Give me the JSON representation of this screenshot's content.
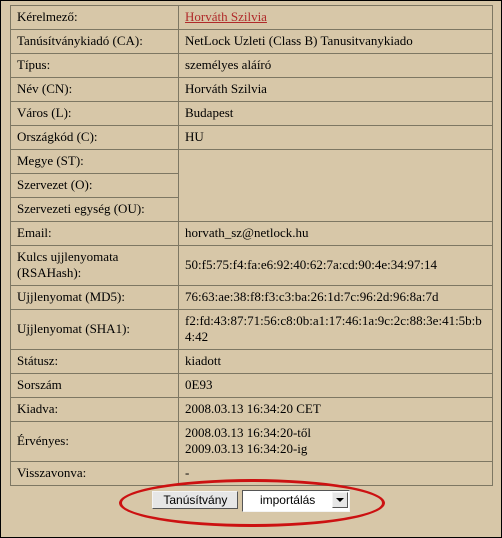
{
  "labels": {
    "applicant": "Kérelmező:",
    "ca": "Tanúsítványkiadó (CA):",
    "type": "Típus:",
    "cn": "Név (CN):",
    "city": "Város (L):",
    "country": "Országkód (C):",
    "state": "Megye (ST):",
    "org": "Szervezet (O):",
    "ou": "Szervezeti egység (OU):",
    "email": "Email:",
    "rsahash": "Kulcs ujjlenyomata (RSAHash):",
    "md5": "Ujjlenyomat (MD5):",
    "sha1": "Ujjlenyomat (SHA1):",
    "status": "Státusz:",
    "serial": "Sorszám",
    "issued": "Kiadva:",
    "valid": "Érvényes:",
    "revoked": "Visszavonva:"
  },
  "values": {
    "applicant": "Horváth Szilvia",
    "ca": "NetLock Uzleti (Class B) Tanusitvanykiado",
    "type": "személyes aláíró",
    "cn": "Horváth Szilvia",
    "city": "Budapest",
    "country": "HU",
    "state": "",
    "org": "",
    "ou": "",
    "email": "horvath_sz@netlock.hu",
    "rsahash": "50:f5:75:f4:fa:e6:92:40:62:7a:cd:90:4e:34:97:14",
    "md5": "76:63:ae:38:f8:f3:c3:ba:26:1d:7c:96:2d:96:8a:7d",
    "sha1": "f2:fd:43:87:71:56:c8:0b:a1:17:46:1a:9c:2c:88:3e:41:5b:b4:42",
    "status": "kiadott",
    "serial": "0E93",
    "issued": "2008.03.13 16:34:20 CET",
    "valid_from": "2008.03.13 16:34:20-től",
    "valid_to": "2009.03.13 16:34:20-ig",
    "revoked": "-"
  },
  "actions": {
    "button_label": "Tanúsítvány",
    "select_value": "importálás"
  }
}
